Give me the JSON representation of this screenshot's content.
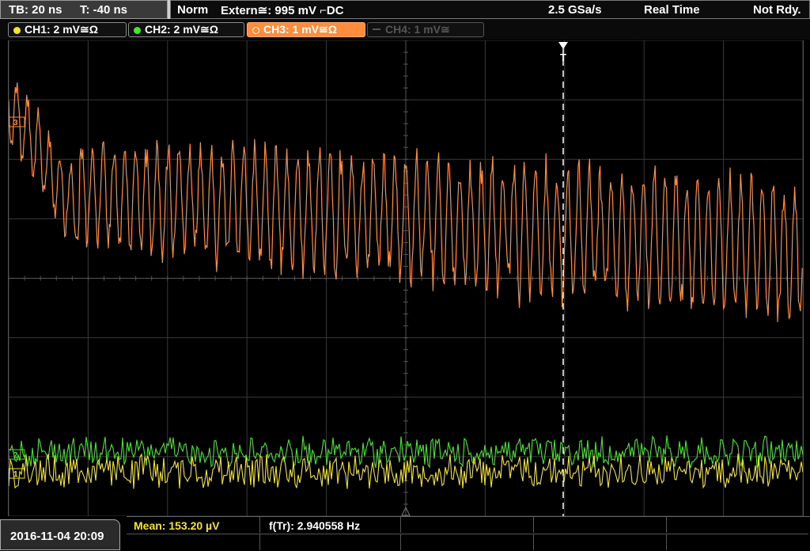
{
  "header": {
    "timebase": "TB: 20 ns",
    "trigger_time": "T: -40 ns",
    "mode": "Norm",
    "trigger_source": "Extern≅: 995 mV",
    "trigger_coupling": "DC",
    "sample_rate": "2.5 GSa/s",
    "acq_mode": "Real Time",
    "status": "Not Rdy."
  },
  "channels": [
    {
      "label": "CH1: 2 mV≅Ω",
      "color": "#f5e42a",
      "active": true
    },
    {
      "label": "CH2: 2 mV≅Ω",
      "color": "#44e62a",
      "active": true
    },
    {
      "label": "CH3: 1 mV≅Ω",
      "color": "#ff8c3a",
      "active": true,
      "selected": true
    },
    {
      "label": "CH4: 1 mV≅",
      "color": "#666666",
      "active": false
    }
  ],
  "markers": {
    "trigger_marker": "T",
    "ch3_marker": "3",
    "ch2_marker": "2",
    "ch1_marker": "1"
  },
  "measurements": {
    "mean": "Mean: 153.20 µV",
    "freq": "f(Tr): 2.940558 Hz"
  },
  "footer": {
    "date": "2016-11-04 20:09"
  },
  "colors": {
    "ch1": "#f5e42a",
    "ch2": "#44e62a",
    "ch3": "#ff8c3a",
    "grid": "#3a3a3a"
  }
}
